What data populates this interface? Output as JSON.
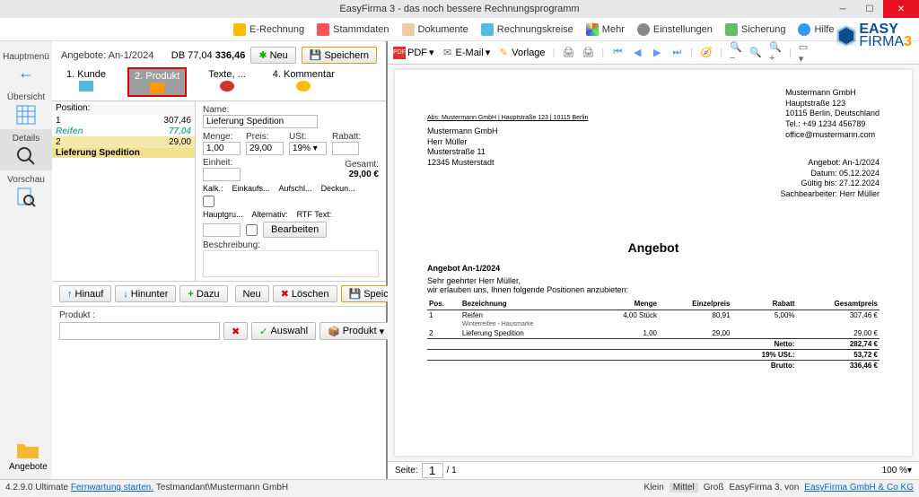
{
  "app": {
    "title": "EasyFirma 3 - das noch bessere Rechnungsprogramm",
    "brand": "EASY FIRMA 3"
  },
  "toolbar": {
    "items": [
      "E-Rechnung",
      "Stammdaten",
      "Dokumente",
      "Rechnungskreise",
      "Mehr",
      "Einstellungen",
      "Sicherung",
      "Hilfe"
    ]
  },
  "rail": {
    "main_menu": "Hauptmenü",
    "items": [
      "Übersicht",
      "Details",
      "Vorschau"
    ],
    "bottom": "Angebote"
  },
  "doc": {
    "number_label": "Angebote: An-1/2024",
    "db_label": "DB 77,04",
    "total": "336,46",
    "btn_new": "Neu",
    "btn_save": "Speichern"
  },
  "tabs": [
    "1. Kunde",
    "2. Produkt",
    "Texte, ...",
    "4. Kommentar"
  ],
  "positions": {
    "header": "Position:",
    "rows": [
      {
        "pos": "1",
        "price": "307,46",
        "name": "Reifen",
        "name_price": "77,04"
      },
      {
        "pos": "2",
        "price": "29,00",
        "name": "Lieferung Spedition"
      }
    ]
  },
  "detail": {
    "name_label": "Name:",
    "name_value": "Lieferung Spedition",
    "menge_label": "Menge:",
    "menge": "1,00",
    "preis_label": "Preis:",
    "preis": "29,00",
    "ust_label": "USt:",
    "ust": "19% ▾",
    "rabatt_label": "Rabatt:",
    "rabatt": "",
    "einheit_label": "Einheit:",
    "gesamt_label": "Gesamt:",
    "gesamt": "29,00 €",
    "kalk": "Kalk.:",
    "einkauf": "Einkaufs...",
    "aufschl": "Aufschl...",
    "deckun": "Deckun...",
    "hauptgr": "Hauptgru...",
    "alt": "Alternativ:",
    "rtf": "RTF Text:",
    "bearbeiten": "Bearbeiten",
    "beschr": "Beschreibung:"
  },
  "actions": {
    "hinauf": "Hinauf",
    "hinunter": "Hinunter",
    "dazu": "Dazu",
    "neu": "Neu",
    "loeschen": "Löschen",
    "speichern": "Speichern",
    "produkt_label": "Produkt :",
    "auswahl": "Auswahl",
    "produkt": "Produkt"
  },
  "preview_tb": {
    "pdf": "PDF",
    "email": "E-Mail",
    "vorlage": "Vorlage"
  },
  "invoice": {
    "sender": "Abs: Mustermann GmbH | Hauptstraße 123 | 10115 Berlin",
    "addr": [
      "Mustermann GmbH",
      "Herr Müller",
      "Musterstraße 11",
      "12345 Musterstadt"
    ],
    "company": [
      "Mustermann GmbH",
      "Hauptstraße 123",
      "10115 Berlin, Deutschland",
      "Tel.: +49 1234 456789",
      "office@mustermann.com"
    ],
    "meta": [
      "Angebot: An-1/2024",
      "Datum: 05.12.2024",
      "Gültig bis: 27.12.2024",
      "Sachbearbeiter: Herr Müller"
    ],
    "heading": "Angebot",
    "ref": "Angebot An-1/2024",
    "salutation": "Sehr geehrter Herr Müller,",
    "intro": "wir erlauben uns, Ihnen folgende Positionen anzubieten:",
    "cols": [
      "Pos.",
      "Bezeichnung",
      "Menge",
      "Einzelpreis",
      "Rabatt",
      "Gesamtpreis"
    ],
    "lines": [
      {
        "pos": "1",
        "name": "Reifen",
        "sub": "Winterreifen - Hausmarke",
        "menge": "4,00 Stück",
        "ep": "80,91",
        "rabatt": "5,00%",
        "gp": "307,46 €"
      },
      {
        "pos": "2",
        "name": "Lieferung Spedition",
        "sub": "",
        "menge": "1,00",
        "ep": "29,00",
        "rabatt": "",
        "gp": "29,00 €"
      }
    ],
    "totals": [
      {
        "label": "Netto:",
        "val": "282,74 €"
      },
      {
        "label": "19% USt.:",
        "val": "53,72 €"
      },
      {
        "label": "Brutto:",
        "val": "336,46 €"
      }
    ]
  },
  "preview_foot": {
    "seite": "Seite:",
    "page": "1",
    "of": "/ 1",
    "zoom": "100 %"
  },
  "status": {
    "version": "4.2.9.0 Ultimate",
    "fernwartung": "Fernwartung starten.",
    "mandant": "Testmandant\\Mustermann GmbH",
    "sizes": [
      "Klein",
      "Mittel",
      "Groß"
    ],
    "product": "EasyFirma 3, von",
    "vendor": "EasyFirma GmbH & Co KG"
  }
}
